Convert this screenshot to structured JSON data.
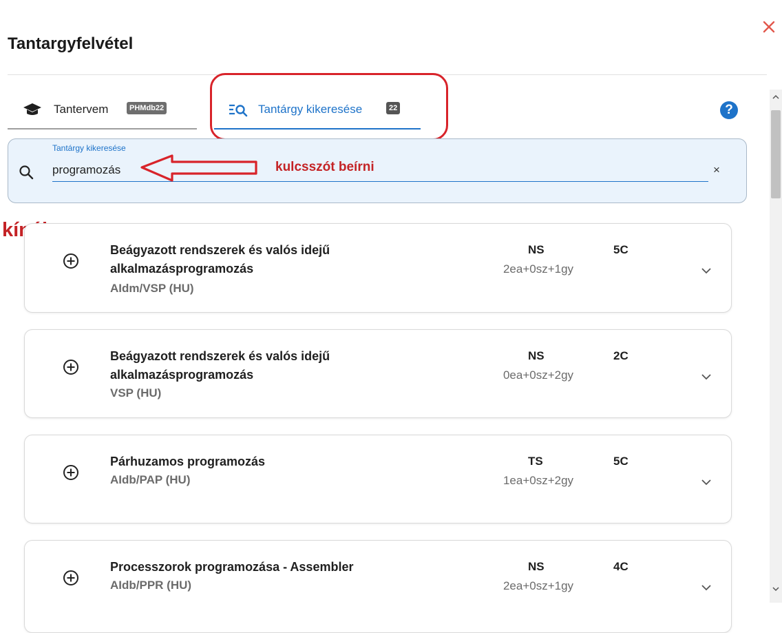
{
  "dialog": {
    "title": "Tantargyfelvétel",
    "close_icon": "close-x-icon"
  },
  "tabs": [
    {
      "label": "Tantervem",
      "badge": "PHMdb22",
      "icon": "graduation-cap-icon",
      "active": false
    },
    {
      "label": "Tantárgy kikeresése",
      "badge": "22",
      "icon": "list-search-icon",
      "active": true
    }
  ],
  "help": {
    "glyph": "?"
  },
  "search": {
    "label": "Tantárgy kikeresése",
    "value": "programozás",
    "clear_glyph": "×"
  },
  "annotations": {
    "arrow_note": "kulcsszót beírni",
    "offer_label": "kínálat:"
  },
  "courses": [
    {
      "name": "Beágyazott rendszerek és valós idejű alkalmazásprogramozás",
      "code": "AIdm/VSP (HU)",
      "type": "NS",
      "hours": "2ea+0sz+1gy",
      "credit": "5C"
    },
    {
      "name": "Beágyazott rendszerek és valós idejű alkalmazásprogramozás",
      "code": "VSP (HU)",
      "type": "NS",
      "hours": "0ea+0sz+2gy",
      "credit": "2C"
    },
    {
      "name": "Párhuzamos programozás",
      "code": "AIdb/PAP (HU)",
      "type": "TS",
      "hours": "1ea+0sz+2gy",
      "credit": "5C"
    },
    {
      "name": "Processzorok programozása - Assembler",
      "code": "AIdb/PPR (HU)",
      "type": "NS",
      "hours": "2ea+0sz+1gy",
      "credit": "4C"
    }
  ],
  "colors": {
    "accent": "#1e73c9",
    "annotation_red": "#d8232a",
    "search_bg": "#eaf3fc"
  }
}
